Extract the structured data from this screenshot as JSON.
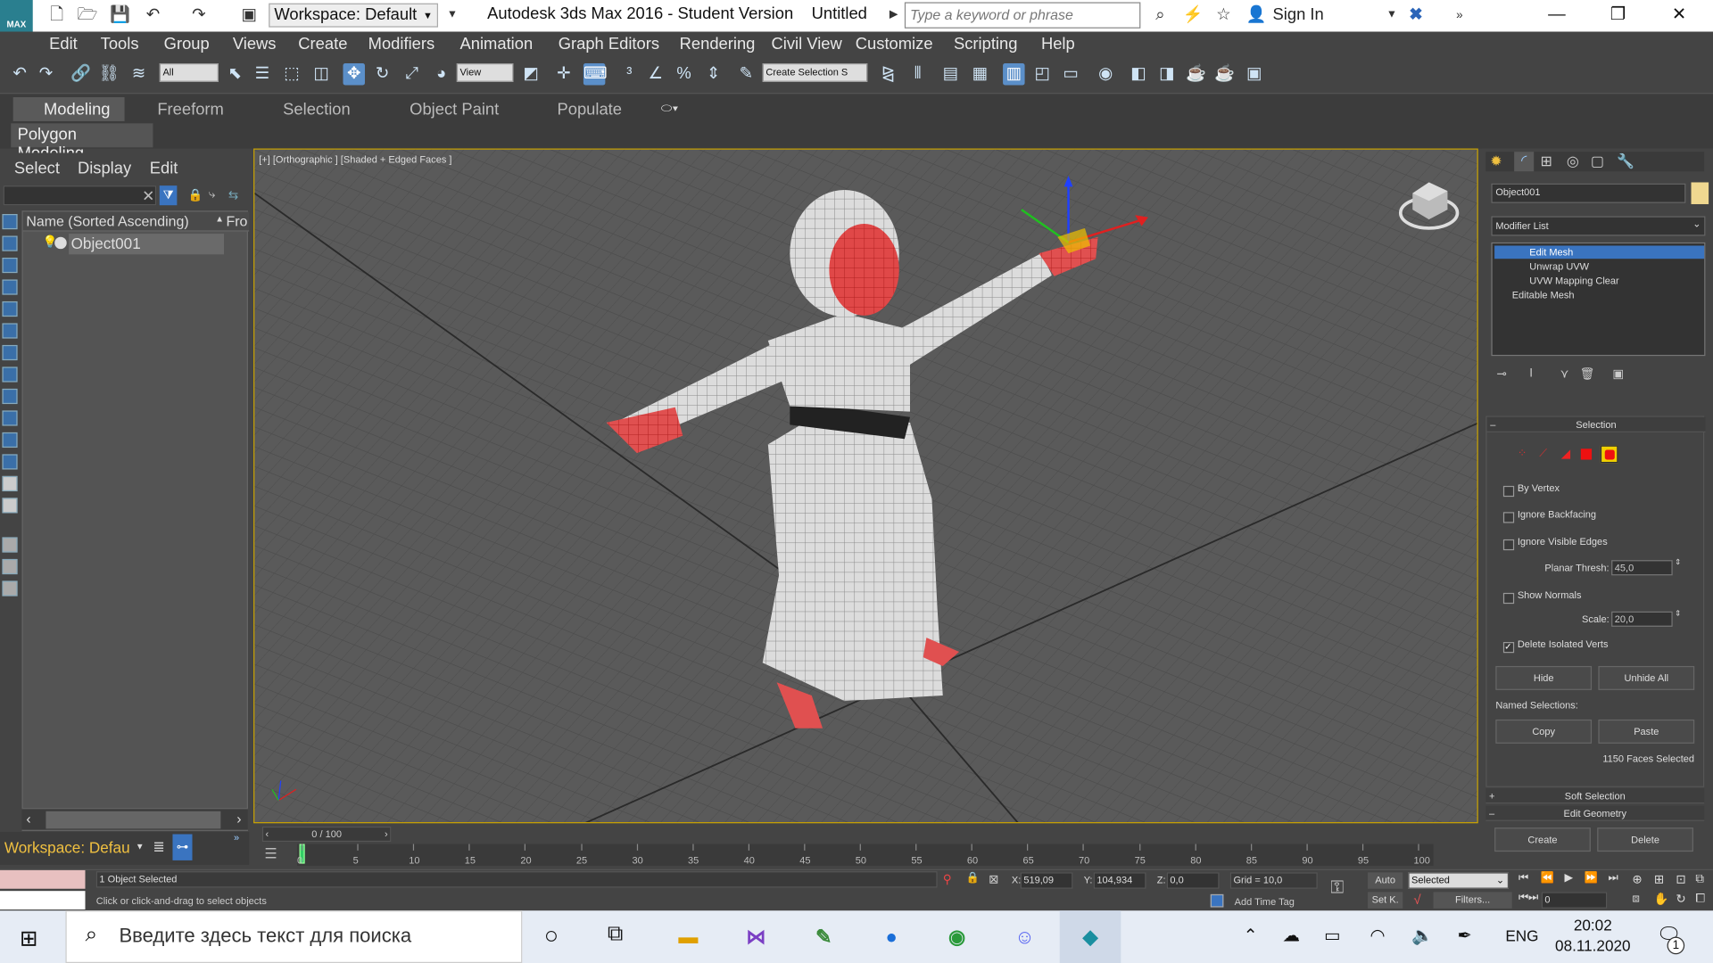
{
  "titlebar": {
    "workspace": "Workspace: Default",
    "title": "Autodesk 3ds Max 2016 - Student Version",
    "document": "Untitled",
    "search_placeholder": "Type a keyword or phrase",
    "signin": "Sign In"
  },
  "menu": [
    "Edit",
    "Tools",
    "Group",
    "Views",
    "Create",
    "Modifiers",
    "Animation",
    "Graph Editors",
    "Rendering",
    "Civil View",
    "Customize",
    "Scripting",
    "Help"
  ],
  "toolbar": {
    "selection_filter": "All",
    "reference_coord": "View",
    "named_selection": "Create Selection S"
  },
  "ribbon": {
    "tabs": [
      "Modeling",
      "Freeform",
      "Selection",
      "Object Paint",
      "Populate"
    ],
    "sub": "Polygon Modeling"
  },
  "explorer": {
    "menu": [
      "Select",
      "Display",
      "Edit"
    ],
    "col_name": "Name (Sorted Ascending)",
    "col_fr": "Fro",
    "object": "Object001"
  },
  "viewport": {
    "label": "[+] [Orthographic ] [Shaded + Edged Faces ]"
  },
  "command_panel": {
    "object_name": "Object001",
    "modifier_list": "Modifier List",
    "stack": [
      "Edit Mesh",
      "Unwrap UVW",
      "UVW Mapping Clear",
      "Editable Mesh"
    ],
    "selection_title": "Selection",
    "by_vertex": "By Vertex",
    "ignore_backfacing": "Ignore Backfacing",
    "ignore_visible_edges": "Ignore Visible Edges",
    "planar_thresh_label": "Planar Thresh:",
    "planar_thresh": "45,0",
    "show_normals": "Show Normals",
    "scale_label": "Scale:",
    "scale": "20,0",
    "delete_isolated": "Delete Isolated Verts",
    "hide": "Hide",
    "unhide_all": "Unhide All",
    "named_selections": "Named Selections:",
    "copy": "Copy",
    "paste": "Paste",
    "faces_selected": "1150 Faces Selected",
    "soft_selection": "Soft Selection",
    "edit_geometry": "Edit Geometry",
    "create": "Create",
    "delete": "Delete"
  },
  "timeline": {
    "slider": "0 / 100",
    "ticks": [
      "0",
      "5",
      "10",
      "15",
      "20",
      "25",
      "30",
      "35",
      "40",
      "45",
      "50",
      "55",
      "60",
      "65",
      "70",
      "75",
      "80",
      "85",
      "90",
      "95",
      "100"
    ]
  },
  "workspace_bottom": "Workspace: Defau",
  "status": {
    "selected": "1 Object Selected",
    "prompt": "Click or click-and-drag to select objects",
    "x_label": "X:",
    "x": "519,09",
    "y_label": "Y:",
    "y": "104,934",
    "z_label": "Z:",
    "z": "0,0",
    "grid": "Grid = 10,0",
    "add_time_tag": "Add Time Tag",
    "auto": "Auto",
    "set_key": "Set K.",
    "key_mode": "Selected",
    "filters": "Filters...",
    "frame": "0"
  },
  "taskbar": {
    "search": "Введите здесь текст для поиска",
    "lang": "ENG",
    "time": "20:02",
    "date": "08.11.2020",
    "notif": "1"
  }
}
